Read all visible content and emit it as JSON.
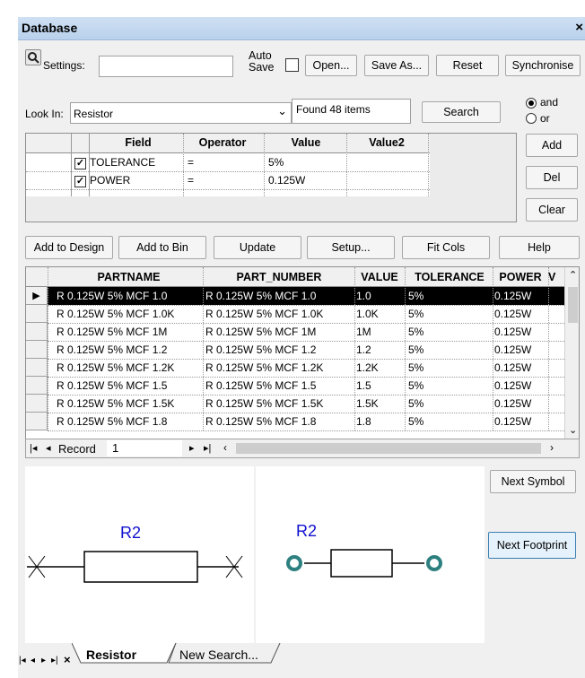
{
  "window": {
    "title": "Database",
    "close_glyph": "×"
  },
  "toolbar": {
    "settings_label": "Settings:",
    "settings_value": "",
    "auto_save_line1": "Auto",
    "auto_save_line2": "Save",
    "auto_save_checked": false,
    "open_label": "Open...",
    "save_as_label": "Save As...",
    "reset_label": "Reset",
    "synchronise_label": "Synchronise"
  },
  "search": {
    "look_in_label": "Look In:",
    "look_in_value": "Resistor",
    "found_text": "Found 48 items",
    "search_label": "Search",
    "and_label": "and",
    "or_label": "or",
    "logic_selected": "and",
    "add_label": "Add",
    "del_label": "Del",
    "clear_label": "Clear"
  },
  "criteria": {
    "headers": [
      "Field",
      "Operator",
      "Value",
      "Value2"
    ],
    "rows": [
      {
        "checked": true,
        "field": "TOLERANCE",
        "operator": "=",
        "value": "5%",
        "value2": ""
      },
      {
        "checked": true,
        "field": "POWER",
        "operator": "=",
        "value": "0.125W",
        "value2": ""
      }
    ]
  },
  "actions": {
    "add_to_design": "Add to Design",
    "add_to_bin": "Add to Bin",
    "update": "Update",
    "setup": "Setup...",
    "fit_cols": "Fit Cols",
    "help": "Help"
  },
  "results": {
    "headers": [
      "PARTNAME",
      "PART_NUMBER",
      "VALUE",
      "TOLERANCE",
      "POWER",
      "V"
    ],
    "selected_row": 0,
    "rows": [
      [
        "R 0.125W 5% MCF 1.0",
        "R 0.125W 5% MCF 1.0",
        "1.0",
        "5%",
        "0.125W"
      ],
      [
        "R 0.125W 5% MCF 1.0K",
        "R 0.125W 5% MCF 1.0K",
        "1.0K",
        "5%",
        "0.125W"
      ],
      [
        "R 0.125W 5% MCF 1M",
        "R 0.125W 5% MCF 1M",
        "1M",
        "5%",
        "0.125W"
      ],
      [
        "R 0.125W 5% MCF 1.2",
        "R 0.125W 5% MCF 1.2",
        "1.2",
        "5%",
        "0.125W"
      ],
      [
        "R 0.125W 5% MCF 1.2K",
        "R 0.125W 5% MCF 1.2K",
        "1.2K",
        "5%",
        "0.125W"
      ],
      [
        "R 0.125W 5% MCF 1.5",
        "R 0.125W 5% MCF 1.5",
        "1.5",
        "5%",
        "0.125W"
      ],
      [
        "R 0.125W 5% MCF 1.5K",
        "R 0.125W 5% MCF 1.5K",
        "1.5K",
        "5%",
        "0.125W"
      ],
      [
        "R 0.125W 5% MCF 1.8",
        "R 0.125W 5% MCF 1.8",
        "1.8",
        "5%",
        "0.125W"
      ]
    ]
  },
  "navigator": {
    "record_label": "Record",
    "record_value": "1"
  },
  "preview": {
    "symbol_ref": "R2",
    "footprint_ref": "R2",
    "next_symbol": "Next Symbol",
    "next_footprint": "Next Footprint"
  },
  "tabs": {
    "items": [
      "Resistor",
      "New Search..."
    ],
    "active": "Resistor"
  },
  "colors": {
    "ref_text": "#1010d0",
    "pad": "#2e8080",
    "selected_row_bg": "#000000"
  }
}
